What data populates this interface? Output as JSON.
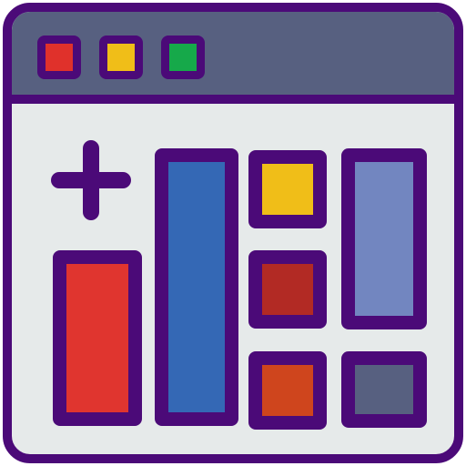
{
  "window": {
    "titlebar": {
      "controls": [
        {
          "name": "close",
          "color": "#e0312b"
        },
        {
          "name": "minimize",
          "color": "#f0be18"
        },
        {
          "name": "maximize",
          "color": "#16a94a"
        }
      ]
    }
  },
  "content": {
    "add_icon": "plus-icon",
    "tiles": [
      {
        "name": "tall-red",
        "color": "#e0352f"
      },
      {
        "name": "tall-blue",
        "color": "#3468b5"
      },
      {
        "name": "yellow",
        "color": "#f0be18"
      },
      {
        "name": "maroon",
        "color": "#b22a24"
      },
      {
        "name": "orange",
        "color": "#cf451d"
      },
      {
        "name": "lavender",
        "color": "#7286c0"
      },
      {
        "name": "slate",
        "color": "#576080"
      }
    ]
  },
  "colors": {
    "outline": "#4b0a78",
    "titlebar": "#576080",
    "background": "#e6eaea"
  }
}
